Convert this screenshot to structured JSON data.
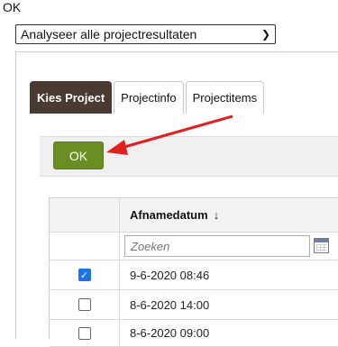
{
  "top_label": "OK",
  "select": {
    "value": "Analyseer alle projectresultaten",
    "chevron": "chevron-down-icon"
  },
  "tabs": [
    {
      "label": "Kies Project",
      "active": true
    },
    {
      "label": "Projectinfo",
      "active": false
    },
    {
      "label": "Projectitems",
      "active": false
    }
  ],
  "toolbar": {
    "ok_label": "OK"
  },
  "table": {
    "header": {
      "date_label": "Afnamedatum",
      "sort_arrow": "↓"
    },
    "filter": {
      "placeholder": "Zoeken",
      "calendar_icon": "calendar-icon"
    },
    "rows": [
      {
        "checked": true,
        "date": "9-6-2020 08:46"
      },
      {
        "checked": false,
        "date": "8-6-2020 14:00"
      },
      {
        "checked": false,
        "date": "8-6-2020 09:00"
      }
    ]
  },
  "colors": {
    "ok_button": "#6b8e23",
    "active_tab": "#4a3a32",
    "arrow": "#e0201c",
    "checkbox": "#1a73e8"
  }
}
